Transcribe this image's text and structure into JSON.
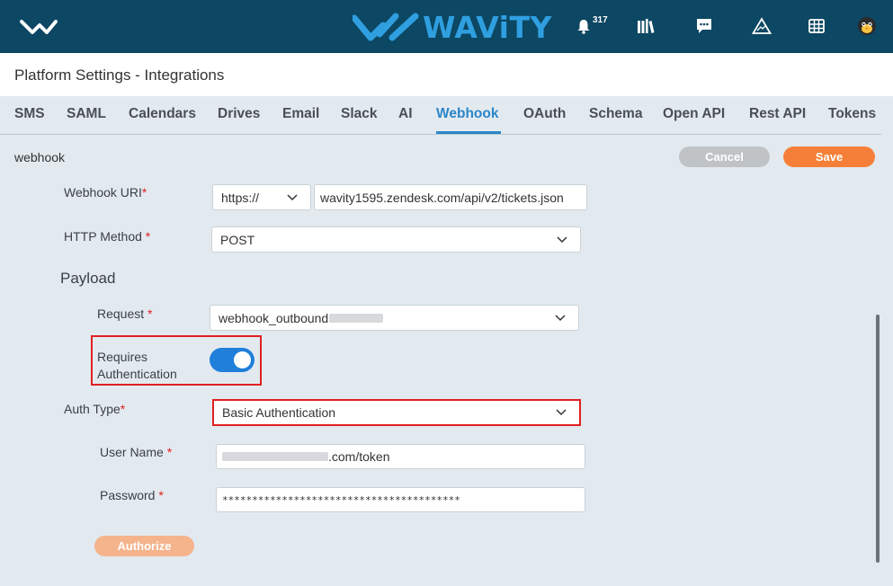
{
  "header": {
    "brand": "WAViTY",
    "notification_count": "317",
    "icons": [
      "menu-logo-icon",
      "bell-icon",
      "library-icon",
      "chat-icon",
      "warning-icon",
      "grid-icon",
      "avatar"
    ]
  },
  "page": {
    "title": "Platform Settings - Integrations"
  },
  "tabs": [
    {
      "label": "SMS"
    },
    {
      "label": "SAML"
    },
    {
      "label": "Calendars"
    },
    {
      "label": "Drives"
    },
    {
      "label": "Email"
    },
    {
      "label": "Slack"
    },
    {
      "label": "AI"
    },
    {
      "label": "Webhook"
    },
    {
      "label": "OAuth"
    },
    {
      "label": "Schema"
    },
    {
      "label": "Open API"
    },
    {
      "label": "Rest API"
    },
    {
      "label": "Tokens"
    }
  ],
  "active_tab": "Webhook",
  "section": {
    "title": "webhook",
    "cancel_label": "Cancel",
    "save_label": "Save"
  },
  "form": {
    "webhook_uri": {
      "label": "Webhook URI",
      "required_mark": "*",
      "protocol": "https://",
      "value": "wavity1595.zendesk.com/api/v2/tickets.json"
    },
    "http_method": {
      "label": "HTTP Method",
      "required_mark": "*",
      "value": "POST"
    },
    "payload_title": "Payload",
    "request": {
      "label": "Request",
      "required_mark": "*",
      "value": "webhook_outbound"
    },
    "requires_auth": {
      "label_line1": "Requires",
      "label_line2": "Authentication",
      "enabled": true
    },
    "auth_type": {
      "label": "Auth Type",
      "required_mark": "*",
      "value": "Basic Authentication"
    },
    "user_name": {
      "label": "User Name",
      "required_mark": "*",
      "value_suffix": ".com/token"
    },
    "password": {
      "label": "Password",
      "required_mark": "*",
      "value": "****************************************"
    },
    "authorize_label": "Authorize"
  },
  "colors": {
    "header_bg": "#0c4763",
    "accent": "#2a86c8",
    "save": "#f57f38",
    "cancel": "#bfc3c6",
    "toggle_on": "#1f7fd9",
    "highlight": "#e02020"
  }
}
